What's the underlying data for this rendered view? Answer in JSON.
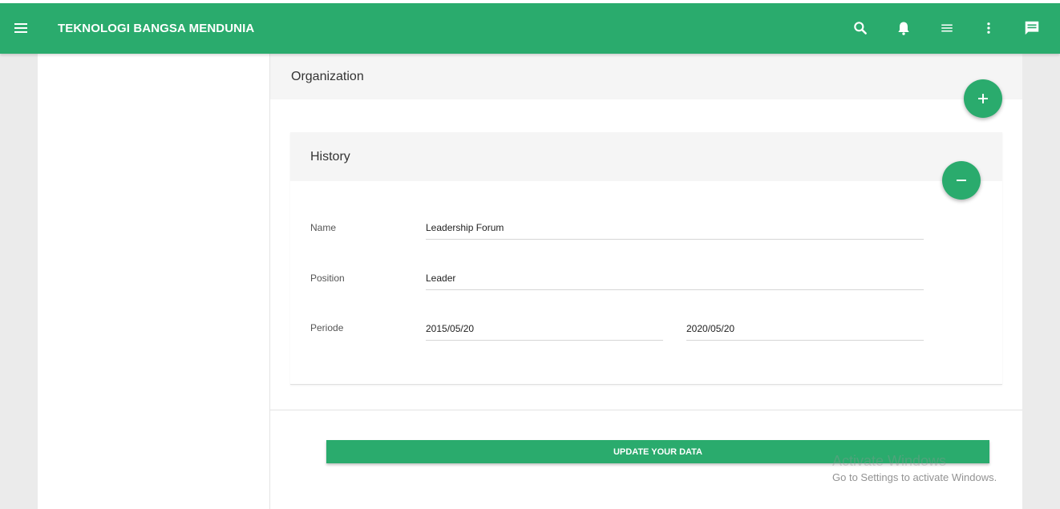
{
  "app": {
    "title": "TEKNOLOGI BANGSA MENDUNIA",
    "accent_color": "#2aab6d",
    "toolbar_icons": [
      "search-icon",
      "bell-icon",
      "list-icon",
      "more-vert-icon",
      "chat-icon"
    ]
  },
  "organization": {
    "title": "Organization",
    "add_icon": "plus-icon"
  },
  "history": {
    "title": "History",
    "remove_icon": "minus-icon",
    "fields": {
      "name_label": "Name",
      "name_value": "Leadership Forum",
      "position_label": "Position",
      "position_value": "Leader",
      "periode_label": "Periode",
      "periode_start": "2015/05/20",
      "periode_end": "2020/05/20"
    }
  },
  "actions": {
    "update_label": "UPDATE YOUR DATA"
  },
  "watermark": {
    "title": "Activate Windows",
    "subtitle": "Go to Settings to activate Windows."
  }
}
